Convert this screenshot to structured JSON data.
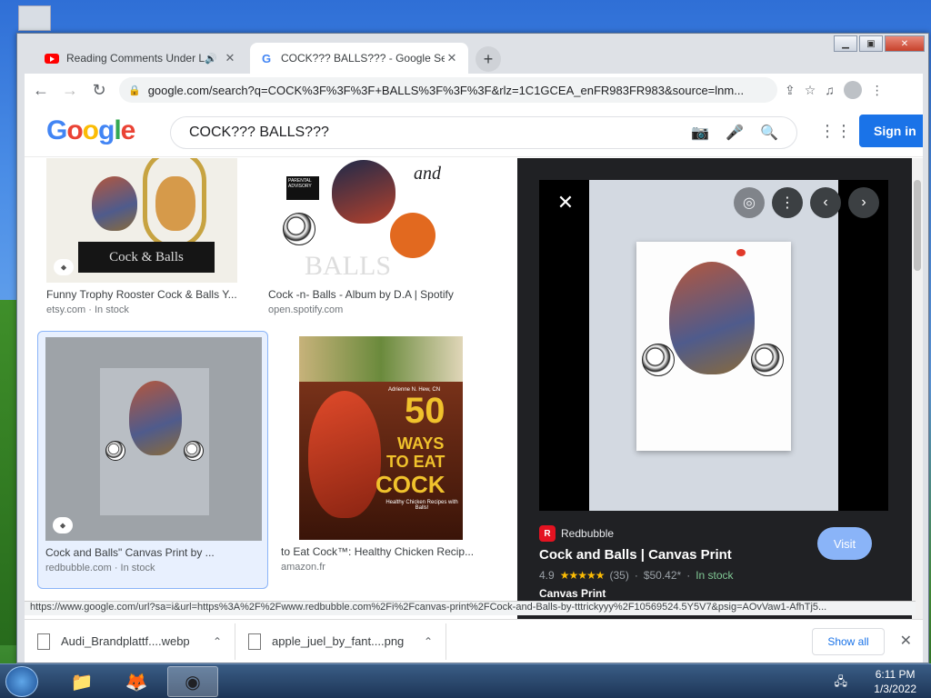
{
  "tabs": [
    {
      "title": "Reading Comments Under L",
      "favicon": "youtube-icon",
      "audio": true
    },
    {
      "title": "COCK??? BALLS??? - Google Sea",
      "favicon": "google-icon"
    }
  ],
  "address": "google.com/search?q=COCK%3F%3F%3F+BALLS%3F%3F%3F&rlz=1C1GCEA_enFR983FR983&source=lnm...",
  "search": {
    "query": "COCK??? BALLS???",
    "signin": "Sign in"
  },
  "results": [
    {
      "caption": "Funny Trophy Rooster Cock & Balls Y...",
      "source": "etsy.com · In stock",
      "trophy_text": "Cock & Balls"
    },
    {
      "caption": "Cock -n- Balls - Album by D.A | Spotify",
      "source": "open.spotify.com",
      "cover_text": "and",
      "cover_bottom": "BALLS",
      "advisory": "PARENTAL ADVISORY"
    },
    {
      "caption": "Cock and Balls\" Canvas Print by ...",
      "source": "redbubble.com · In stock"
    },
    {
      "caption": "to Eat Cock™: Healthy Chicken Recip...",
      "source": "amazon.fr",
      "book_author": "Adrienne N. Hew, CN",
      "book_num": "50",
      "book_line1": "WAYS",
      "book_line2": "TO EAT",
      "book_line3": "COCK",
      "book_sub": "Healthy Chicken Recipes with Balls!"
    }
  ],
  "preview": {
    "source": "Redbubble",
    "title": "Cock and Balls | Canvas Print",
    "rating": "4.9",
    "stars": "★★★★★",
    "reviews": "(35)",
    "price": "$50.42*",
    "stock": "In stock",
    "subtitle": "Canvas Print",
    "visit": "Visit"
  },
  "status_url": "https://www.google.com/url?sa=i&url=https%3A%2F%2Fwww.redbubble.com%2Fi%2Fcanvas-print%2FCock-and-Balls-by-tttrickyyy%2F10569524.5Y5V7&psig=AOvVaw1-AfhTj5...",
  "downloads": [
    {
      "name": "Audi_Brandplattf....webp"
    },
    {
      "name": "apple_juel_by_fant....png"
    }
  ],
  "show_all": "Show all",
  "clock": {
    "time": "6:11 PM",
    "date": "1/3/2022"
  },
  "colors": {
    "accent": "#1a73e8",
    "preview_bg": "#202124"
  }
}
